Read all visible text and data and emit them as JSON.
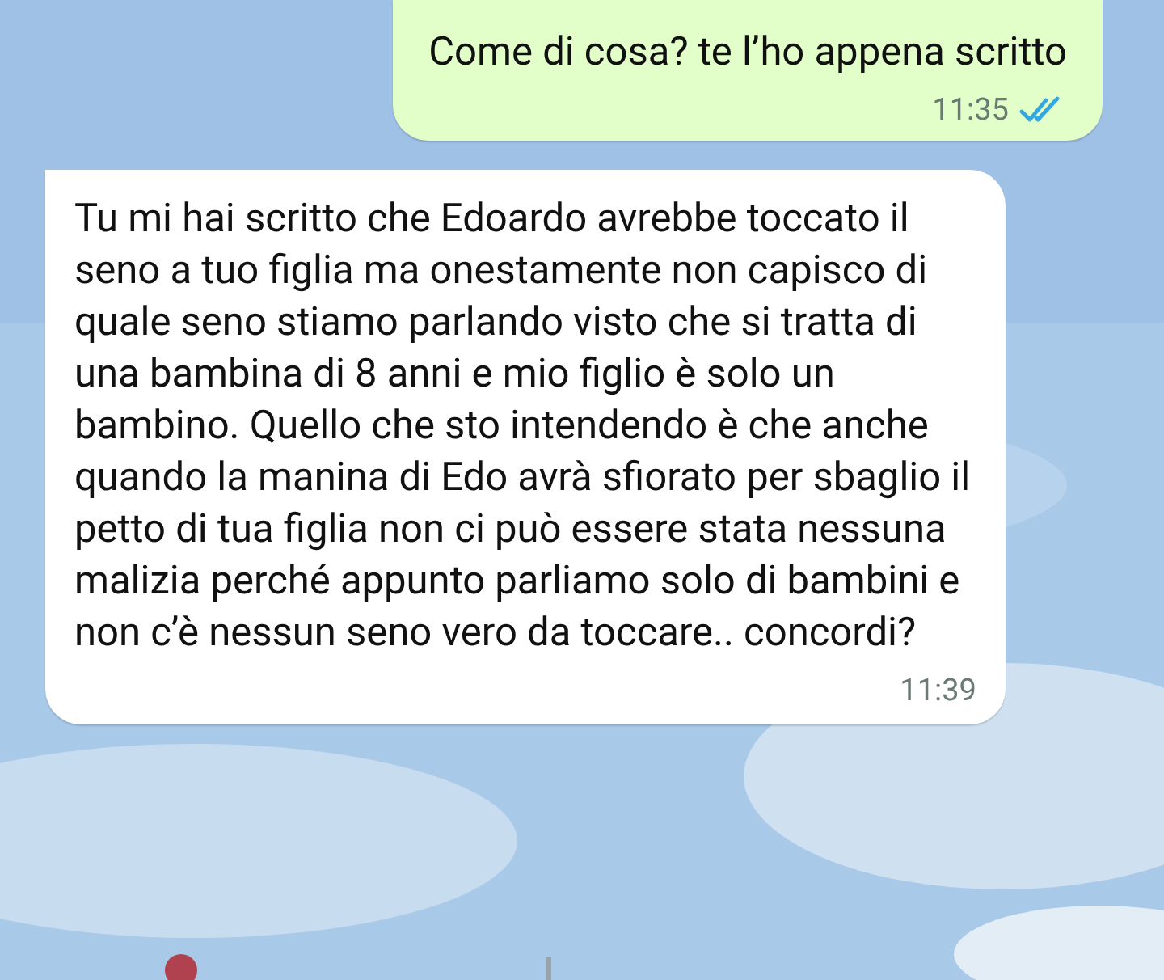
{
  "messages": [
    {
      "kind": "outgoing",
      "text": "Come di cosa? te l’ho appena scritto",
      "time": "11:35",
      "read": true
    },
    {
      "kind": "incoming",
      "text": "Tu mi hai scritto che Edoardo avrebbe toccato il seno a tuo figlia ma onestamente non capisco di quale seno stiamo parlando visto che si tratta di una bambina di 8 anni e mio figlio è solo un bambino. Quello che sto intendendo è che anche quando la manina di Edo avrà sfiorato per sbaglio il petto di tua figlia non ci può essere stata nessuna malizia perché appunto parliamo solo di bambini e non c’è nessun seno vero da toccare.. concordi?",
      "time": "11:39"
    }
  ]
}
